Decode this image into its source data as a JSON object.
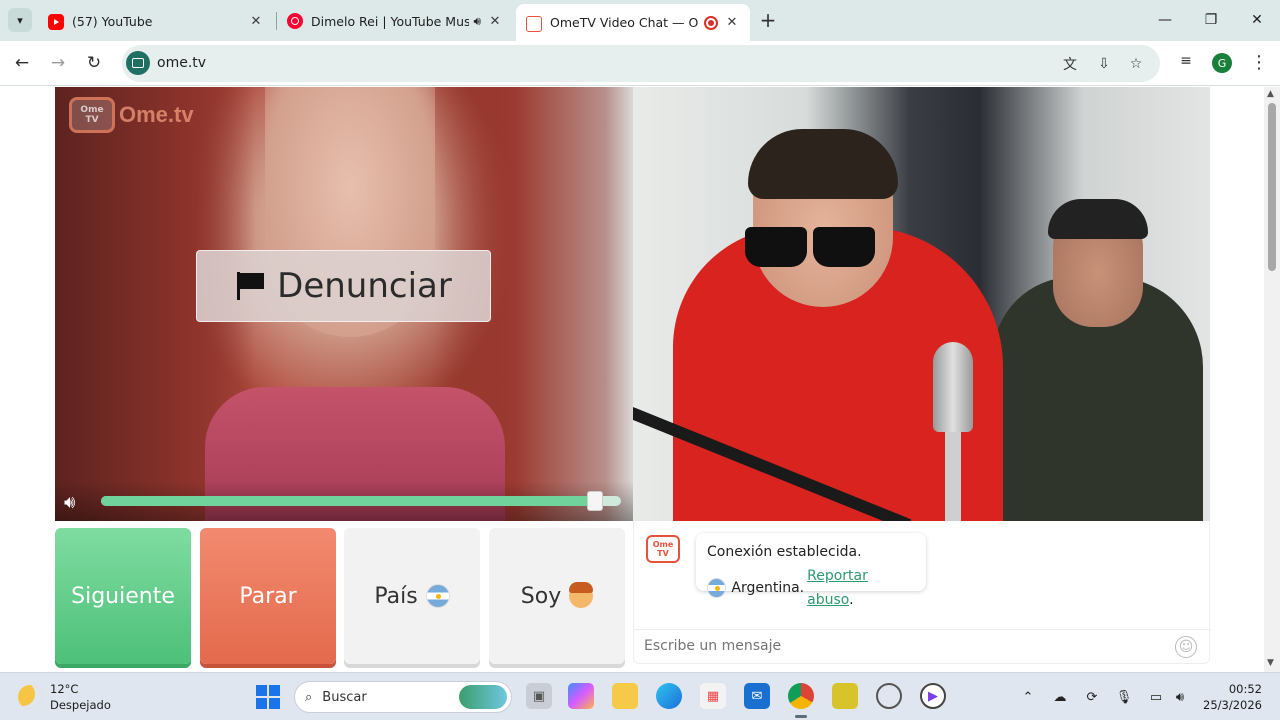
{
  "browser": {
    "tabs": [
      {
        "title": "(57) YouTube",
        "icon": "youtube-icon"
      },
      {
        "title": "Dimelo Rei | YouTube Music",
        "icon": "youtube-music-icon"
      },
      {
        "title": "OmeTV Video Chat — Ome",
        "icon": "ometv-icon",
        "active": true
      }
    ],
    "url": "ome.tv",
    "profile_initial": "G"
  },
  "video": {
    "logo_text": "Ome.tv",
    "logo_tv_line1": "Ome",
    "logo_tv_line2": "TV",
    "report_label": "Denunciar",
    "volume_level": 0.95
  },
  "controls": {
    "next_label": "Siguiente",
    "stop_label": "Parar",
    "country_label": "País",
    "gender_label": "Soy"
  },
  "chat": {
    "logo_line1": "Ome",
    "logo_line2": "TV",
    "status_line": "Conexión establecida.",
    "country": "Argentina.",
    "report_link": "Reportar abuso",
    "report_suffix": ".",
    "input_placeholder": "Escribe un mensaje"
  },
  "taskbar": {
    "temperature": "12°C",
    "weather": "Despejado",
    "search_placeholder": "Buscar",
    "time": "00:52",
    "date": "25/3/2026"
  },
  "colors": {
    "accent_green": "#4dc079",
    "accent_orange": "#e46a4c",
    "link_green": "#2e9a70",
    "brand_red": "#e5533c"
  }
}
